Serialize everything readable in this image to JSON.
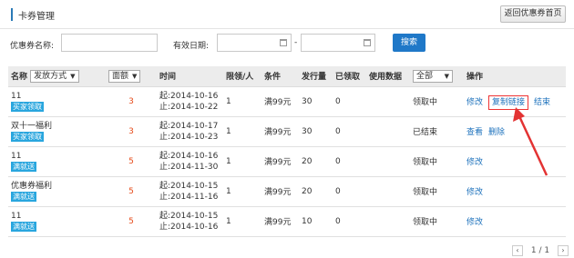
{
  "header": {
    "title": "卡券管理",
    "back_button": "返回优惠券首页"
  },
  "filter": {
    "coupon_name_label": "优惠券名称:",
    "coupon_name_value": "",
    "date_label": "有效日期:",
    "date_sep": "-",
    "search_button": "搜索"
  },
  "table": {
    "headers": {
      "name": "名称",
      "issue_method": "发放方式",
      "face_value": "面额",
      "time": "时间",
      "limit": "限领/人",
      "condition": "条件",
      "issued": "发行量",
      "claimed": "已领取",
      "usage": "使用数据",
      "status_filter": "全部",
      "operation": "操作"
    },
    "rows": [
      {
        "name": "11",
        "badge": "买家领取",
        "face": "3",
        "start": "起:2014-10-16",
        "end": "止:2014-10-22",
        "limit": "1",
        "cond": "满99元",
        "issued": "30",
        "claimed": "0",
        "usage": "",
        "status": "领取中",
        "ops": [
          "修改",
          "复制链接",
          "结束"
        ]
      },
      {
        "name": "双十一福利",
        "badge": "买家领取",
        "face": "3",
        "start": "起:2014-10-17",
        "end": "止:2014-10-23",
        "limit": "1",
        "cond": "满99元",
        "issued": "30",
        "claimed": "0",
        "usage": "",
        "status": "已结束",
        "ops": [
          "查看",
          "删除"
        ]
      },
      {
        "name": "11",
        "badge": "满就送",
        "face": "5",
        "start": "起:2014-10-16",
        "end": "止:2014-11-30",
        "limit": "1",
        "cond": "满99元",
        "issued": "20",
        "claimed": "0",
        "usage": "",
        "status": "领取中",
        "ops": [
          "修改"
        ]
      },
      {
        "name": "优惠券福利",
        "badge": "满就送",
        "face": "5",
        "start": "起:2014-10-15",
        "end": "止:2014-11-16",
        "limit": "1",
        "cond": "满99元",
        "issued": "20",
        "claimed": "0",
        "usage": "",
        "status": "领取中",
        "ops": [
          "修改"
        ]
      },
      {
        "name": "11",
        "badge": "满就送",
        "face": "5",
        "start": "起:2014-10-15",
        "end": "止:2014-10-16",
        "limit": "1",
        "cond": "满99元",
        "issued": "10",
        "claimed": "0",
        "usage": "",
        "status": "领取中",
        "ops": [
          "修改"
        ]
      }
    ]
  },
  "pager": {
    "prev": "‹",
    "text": "1 / 1",
    "next": "›"
  },
  "colors": {
    "accent": "#1f78c8",
    "badge": "#29a6de",
    "face_value": "#e64a19",
    "annotation": "#e33333"
  }
}
